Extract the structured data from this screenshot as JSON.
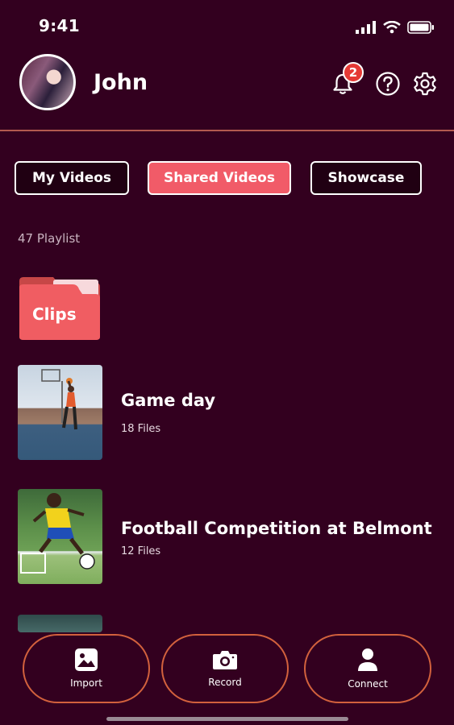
{
  "status_bar": {
    "time": "9:41"
  },
  "header": {
    "user_name": "John",
    "notification_count": "2"
  },
  "tabs": [
    {
      "label": "My Videos",
      "active": false
    },
    {
      "label": "Shared Videos",
      "active": true
    },
    {
      "label": "Showcase",
      "active": false
    }
  ],
  "playlist_count": "47 Playlist",
  "folder": {
    "label": "Clips"
  },
  "items": [
    {
      "title": "Game day",
      "subtitle": "18 Files"
    },
    {
      "title": "Football Competition at Belmont",
      "subtitle": "12 Files"
    }
  ],
  "bottom_nav": [
    {
      "label": "Import",
      "icon": "image-icon"
    },
    {
      "label": "Record",
      "icon": "camera-icon"
    },
    {
      "label": "Connect",
      "icon": "user-icon"
    }
  ],
  "colors": {
    "background": "#33001f",
    "accent": "#f15b68",
    "button_border": "#d2613d",
    "badge": "#e53935"
  }
}
